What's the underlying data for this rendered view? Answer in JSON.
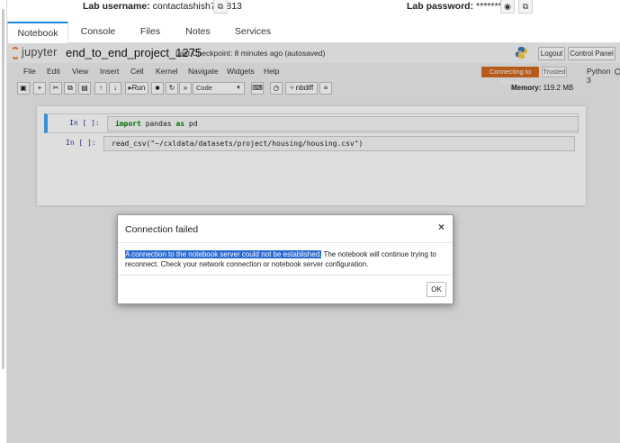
{
  "lab": {
    "username_label": "Lab username:",
    "username_value": "contactashish786813",
    "password_label": "Lab password:",
    "password_value": "*********"
  },
  "tabs": [
    {
      "label": "Notebook",
      "active": true
    },
    {
      "label": "Console",
      "active": false
    },
    {
      "label": "Files",
      "active": false
    },
    {
      "label": "Notes",
      "active": false
    },
    {
      "label": "Services",
      "active": false
    }
  ],
  "jupyter": {
    "logo_text": "jupyter",
    "notebook_title": "end_to_end_project_1275",
    "checkpoint": "Last Checkpoint: 8 minutes ago",
    "autosave": "(autosaved)",
    "logout_label": "Logout",
    "control_panel_label": "Control Panel"
  },
  "menu": {
    "items": [
      "File",
      "Edit",
      "View",
      "Insert",
      "Cell",
      "Kernel",
      "Navigate",
      "Widgets",
      "Help"
    ],
    "kernel_status": "Connecting to kernel",
    "trusted": "Trusted",
    "kernel_name": "Python 3"
  },
  "toolbar": {
    "run_label": "Run",
    "cell_type": "Code",
    "nbdiff_label": "nbdiff",
    "memory_label": "Memory:",
    "memory_value": "119.2 MB"
  },
  "cells": [
    {
      "prompt": "In [ ]:",
      "code_kw1": "import",
      "code_mid": " pandas ",
      "code_kw2": "as",
      "code_tail": " pd"
    },
    {
      "prompt": "In [ ]:",
      "code": "read_csv(\"~/cxldata/datasets/project/housing/housing.csv\")"
    }
  ],
  "modal": {
    "title": "Connection failed",
    "close": "×",
    "body_highlighted": "A connection to the notebook server could not be established.",
    "body_rest": " The notebook will continue trying to reconnect. Check your network connection or notebook server configuration.",
    "ok_label": "OK"
  },
  "colors": {
    "tab_accent": "#1e88e5",
    "kernel_status_bg": "#d2691e",
    "selection_highlight": "#2a6ad3",
    "cell_selected_border": "#42a5f5"
  }
}
